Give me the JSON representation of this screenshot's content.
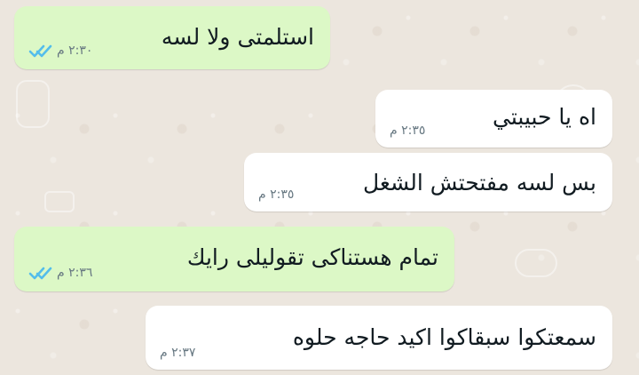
{
  "messages": [
    {
      "text": "استلمتى ولا لسه",
      "time": "٢:٣٠ م",
      "status": "read"
    },
    {
      "text": "اه يا حبيبتي",
      "time": "٢:٣٥ م"
    },
    {
      "text": "بس لسه مفتحتش الشغل",
      "time": "٢:٣٥ م"
    },
    {
      "text": "تمام هستناكى تقوليلى رايك",
      "time": "٢:٣٦ م",
      "status": "read"
    },
    {
      "text": "سمعتكوا سبقاكوا اكيد حاجه حلوه",
      "time": "٢:٣٧ م"
    }
  ],
  "colors": {
    "incoming_bubble": "#ffffff",
    "outgoing_bubble": "#dcf8c6",
    "read_ticks": "#53bdeb"
  },
  "icons": {
    "read_status": "double-check-icon"
  }
}
